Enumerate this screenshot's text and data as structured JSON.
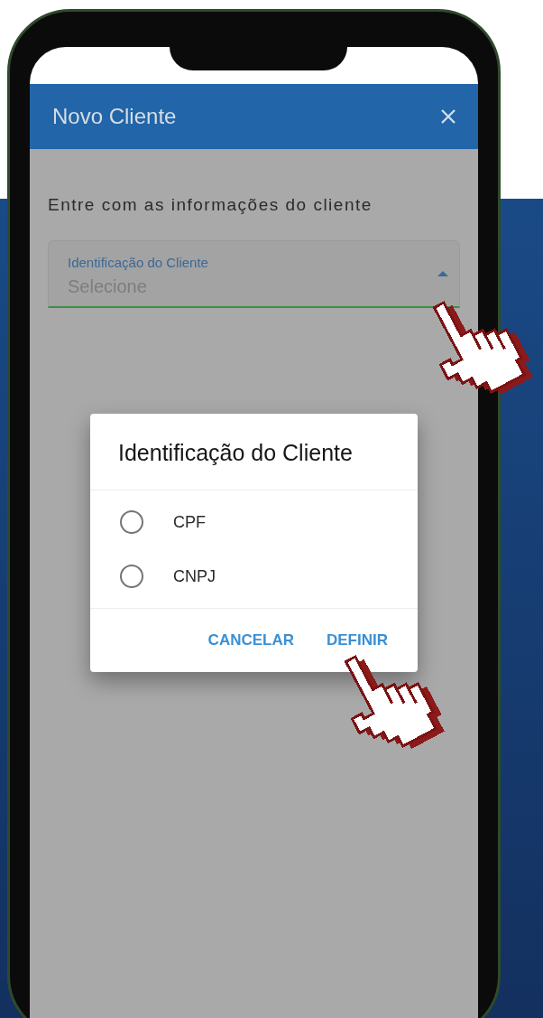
{
  "header": {
    "title": "Novo Cliente"
  },
  "intro": "Entre com as informações do cliente",
  "field": {
    "label": "Identificação do Cliente",
    "placeholder": "Selecione"
  },
  "dialog": {
    "title": "Identificação do Cliente",
    "options": [
      {
        "label": "CPF",
        "selected": false
      },
      {
        "label": "CNPJ",
        "selected": false
      }
    ],
    "buttons": [
      "CANCELAR",
      "DEFINIR"
    ]
  }
}
